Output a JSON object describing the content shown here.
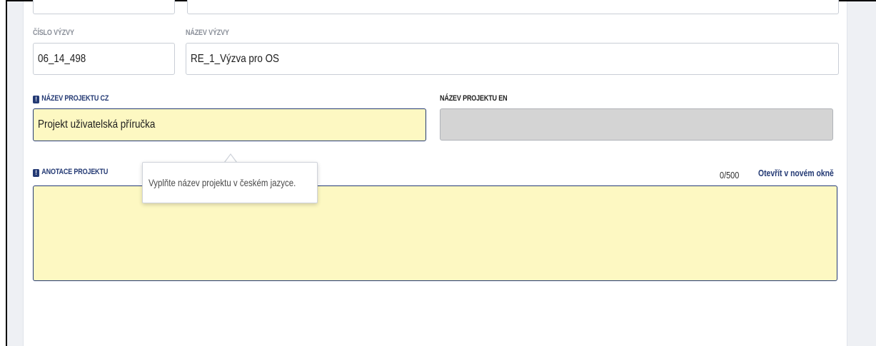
{
  "form": {
    "cislo_vyzvy": {
      "label": "ČÍSLO VÝZVY",
      "value": "06_14_498"
    },
    "nazev_vyzvy": {
      "label": "NÁZEV VÝZVY",
      "value": "RE_1_Výzva pro OS"
    },
    "nazev_projektu_cz": {
      "label": "NÁZEV PROJEKTU CZ",
      "value": "Projekt uživatelská příručka",
      "required_icon": "!"
    },
    "nazev_projektu_en": {
      "label": "NÁZEV PROJEKTU EN",
      "value": ""
    },
    "anotace_projektu": {
      "label": "ANOTACE PROJEKTU",
      "required_icon": "!",
      "value": "",
      "counter": "0/500",
      "open_link": "Otevřít v novém okně"
    }
  },
  "tooltip": {
    "text": "Vyplňte název projektu v českém jazyce."
  },
  "colors": {
    "accent_navy": "#243a74",
    "required_fill": "#fdf8c2",
    "disabled_fill": "#d4d4d4"
  }
}
